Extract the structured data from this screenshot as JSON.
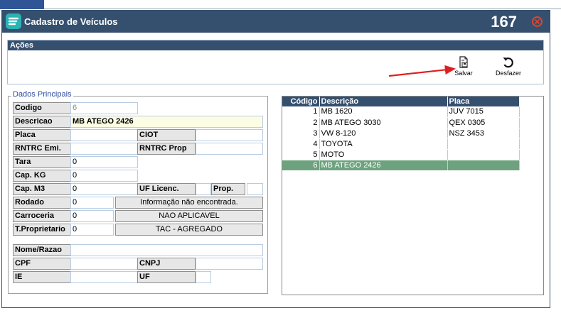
{
  "window": {
    "title": "Cadastro de Veículos",
    "record_number": "167",
    "icons": {
      "app": "app-logo-icon",
      "close": "close-icon"
    },
    "colors": {
      "title_bar": "#35506f",
      "close": "#e0442b",
      "selected_row": "#6ea27f"
    }
  },
  "actions": {
    "header": "Ações",
    "save_label": "Salvar",
    "undo_label": "Desfazer",
    "icons": {
      "save": "save-document-icon",
      "undo": "undo-icon"
    }
  },
  "main_data": {
    "legend": "Dados Principais",
    "codigo": {
      "label": "Codigo",
      "value": "6"
    },
    "descricao": {
      "label": "Descricao",
      "value": "MB ATEGO 2426"
    },
    "placa": {
      "label": "Placa",
      "value": ""
    },
    "ciot": {
      "label": "CIOT",
      "value": ""
    },
    "rntrc_emi": {
      "label": "RNTRC Emi.",
      "value": ""
    },
    "rntrc_prop": {
      "label": "RNTRC Prop",
      "value": ""
    },
    "tara": {
      "label": "Tara",
      "value": "0"
    },
    "cap_kg": {
      "label": "Cap. KG",
      "value": "0"
    },
    "cap_m3": {
      "label": "Cap. M3",
      "value": "0"
    },
    "uf_licenc": {
      "label": "UF Licenc.",
      "value": ""
    },
    "prop": {
      "label": "Prop.",
      "value": ""
    },
    "rodado": {
      "label": "Rodado",
      "value": "0",
      "desc": "Informação não encontrada."
    },
    "carroceria": {
      "label": "Carroceria",
      "value": "0",
      "desc": "NAO APLICAVEL"
    },
    "t_proprietario": {
      "label": "T.Proprietario",
      "value": "0",
      "desc": "TAC - AGREGADO"
    },
    "nome_razao": {
      "label": "Nome/Razao",
      "value": ""
    },
    "cpf": {
      "label": "CPF",
      "value": ""
    },
    "cnpj": {
      "label": "CNPJ",
      "value": ""
    },
    "ie": {
      "label": "IE",
      "value": ""
    },
    "uf": {
      "label": "UF",
      "value": ""
    }
  },
  "grid": {
    "columns": [
      "Código",
      "Descrição",
      "Placa"
    ],
    "rows": [
      {
        "codigo": "1",
        "descricao": "MB 1620",
        "placa": "JUV 7015",
        "selected": false
      },
      {
        "codigo": "2",
        "descricao": "MB ATEGO 3030",
        "placa": "QEX 0305",
        "selected": false
      },
      {
        "codigo": "3",
        "descricao": "VW 8-120",
        "placa": "NSZ 3453",
        "selected": false
      },
      {
        "codigo": "4",
        "descricao": "TOYOTA",
        "placa": "",
        "selected": false
      },
      {
        "codigo": "5",
        "descricao": "MOTO",
        "placa": "",
        "selected": false
      },
      {
        "codigo": "6",
        "descricao": "MB ATEGO 2426",
        "placa": "",
        "selected": true
      }
    ]
  }
}
